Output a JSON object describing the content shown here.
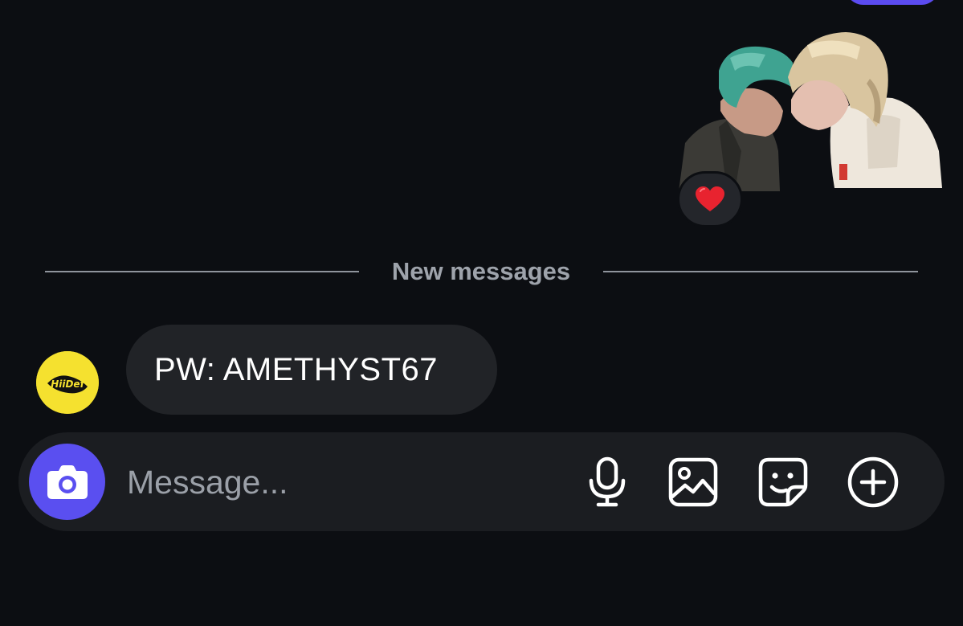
{
  "thread": {
    "reaction_emoji": "❤️",
    "divider_label": "New messages"
  },
  "incoming_message": {
    "text": "PW: AMETHYST67",
    "avatar_text": "HiiDef"
  },
  "composer": {
    "placeholder": "Message..."
  },
  "icons": {
    "camera": "camera-icon",
    "microphone": "microphone-icon",
    "gallery": "gallery-icon",
    "sticker": "sticker-icon",
    "add": "plus-circle-icon"
  },
  "colors": {
    "background": "#0c0e12",
    "accent": "#5a4ff0",
    "bubble": "#212327",
    "composer": "#1b1d21",
    "muted_text": "#9ea3ab"
  }
}
